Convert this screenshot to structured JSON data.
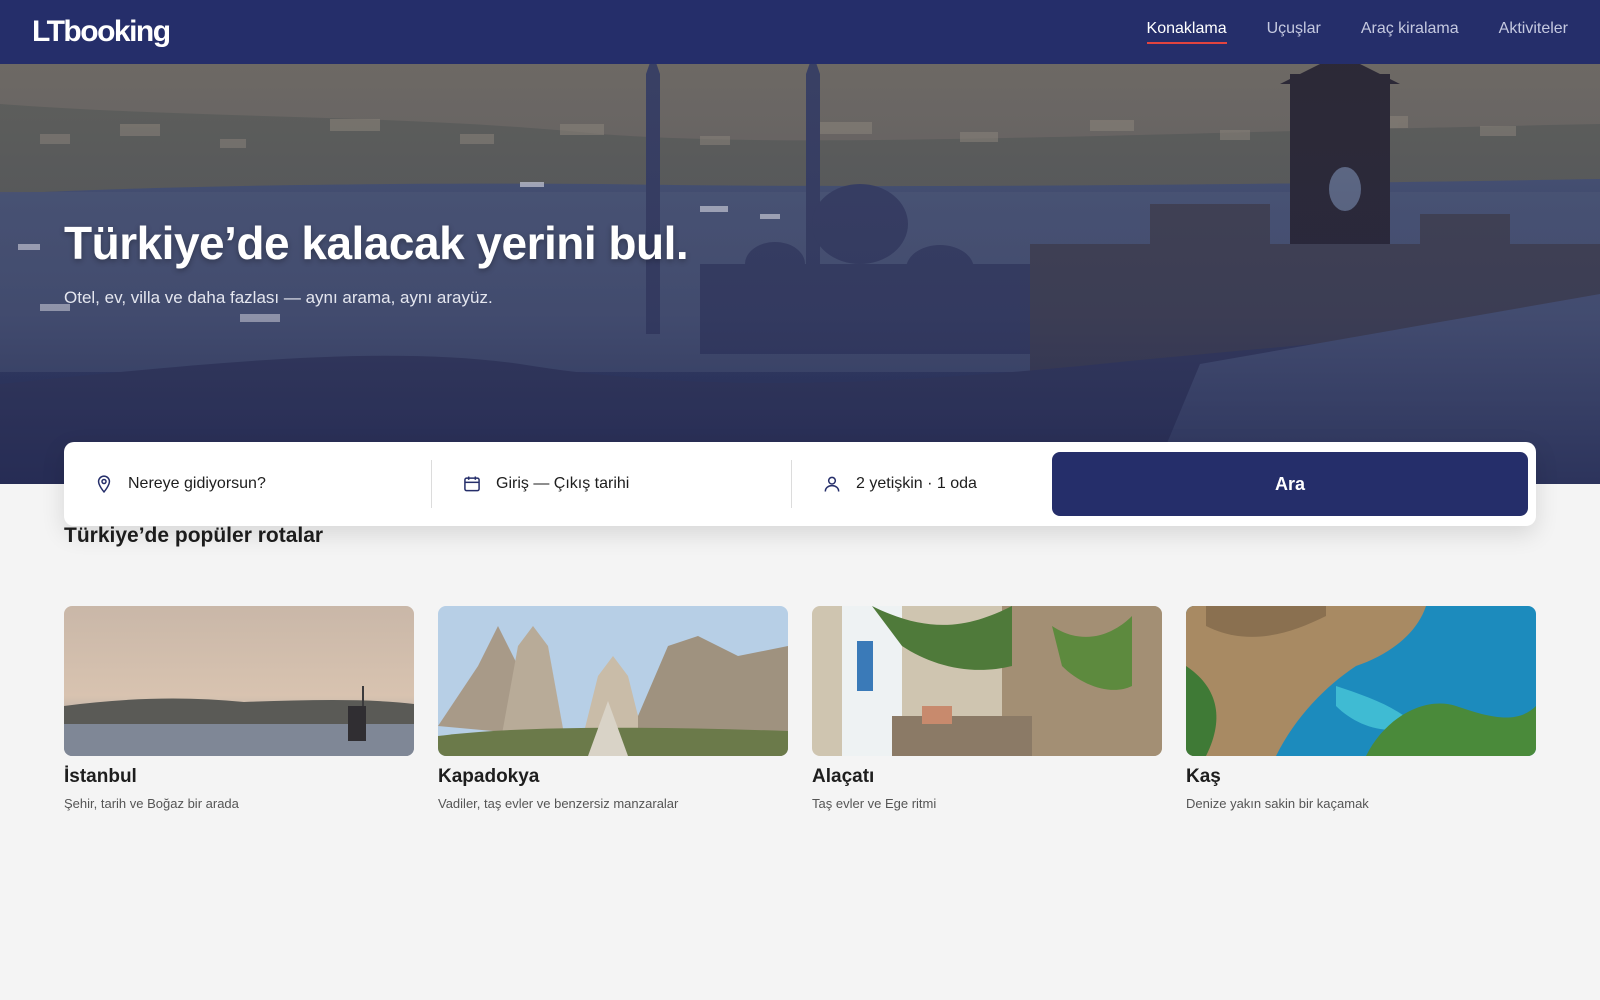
{
  "brand": {
    "logo_text": "LTbooking"
  },
  "nav": {
    "items": [
      {
        "label": "Konaklama",
        "active": true
      },
      {
        "label": "Uçuşlar",
        "active": false
      },
      {
        "label": "Araç kiralama",
        "active": false
      },
      {
        "label": "Aktiviteler",
        "active": false
      }
    ]
  },
  "hero": {
    "title": "Türkiye’de kalacak yerini bul.",
    "subtitle": "Otel, ev, villa ve daha fazlası — aynı arama, aynı arayüz."
  },
  "search": {
    "destination_placeholder": "Nereye gidiyorsun?",
    "dates_placeholder": "Giriş — Çıkış tarihi",
    "guests_value": "2 yetişkin · 1 oda",
    "button_label": "Ara"
  },
  "popular": {
    "title": "Türkiye’de popüler rotalar",
    "cards": [
      {
        "title": "İstanbul",
        "desc": "Şehir, tarih ve Boğaz bir arada"
      },
      {
        "title": "Kapadokya",
        "desc": "Vadiler, taş evler ve benzersiz manzaralar"
      },
      {
        "title": "Alaçatı",
        "desc": "Taş evler ve Ege ritmi"
      },
      {
        "title": "Kaş",
        "desc": "Denize yakın sakin bir kaçamak"
      }
    ]
  },
  "colors": {
    "primary": "#252e6a",
    "accent": "#e2443f",
    "background": "#f4f4f4"
  },
  "icons": {
    "destination": "map-pin-icon",
    "dates": "calendar-icon",
    "guests": "user-icon"
  }
}
